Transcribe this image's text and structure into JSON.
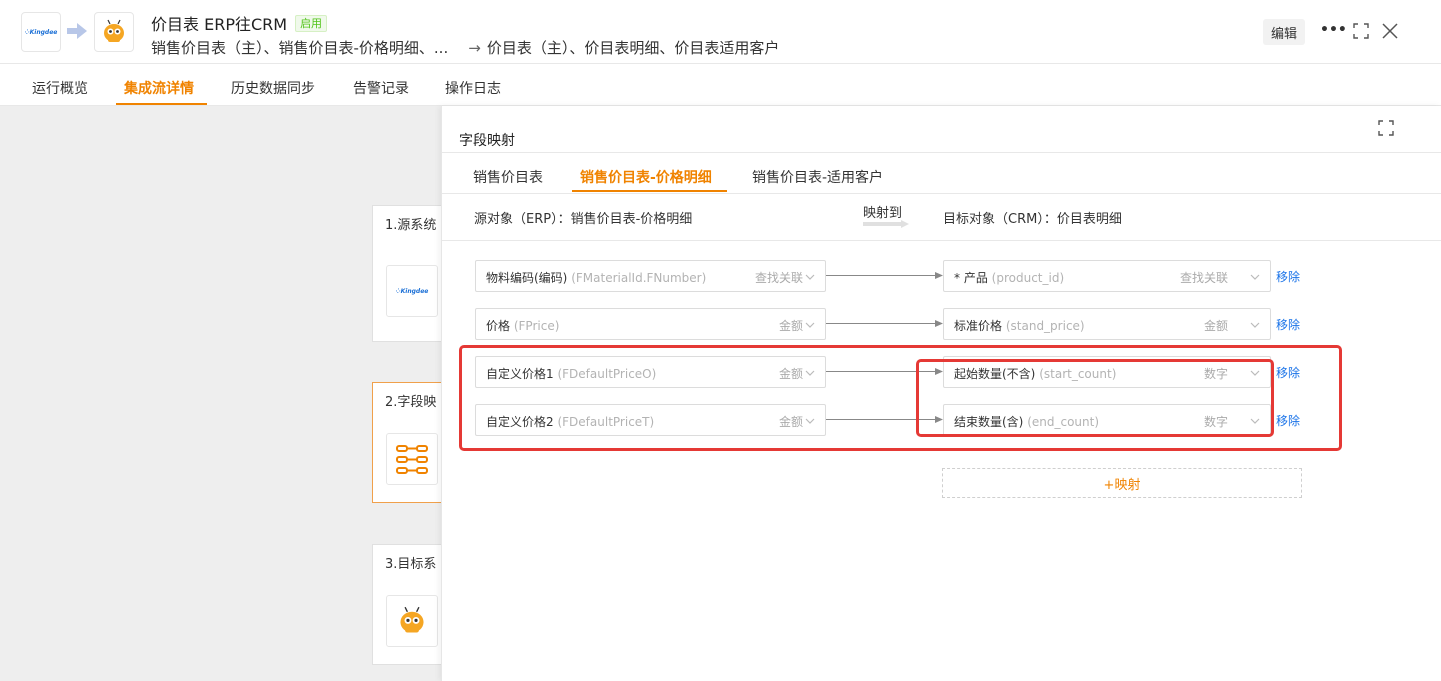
{
  "header": {
    "source_logo_text": "Kingdee",
    "title": "价目表 ERP往CRM",
    "status": "启用",
    "source_objects": "销售价目表（主）、销售价目表-价格明细、...",
    "arrow": "→",
    "target_objects": "价目表（主）、价目表明细、价目表适用客户",
    "edit_label": "编辑",
    "more_label": "•••"
  },
  "tabs": [
    {
      "label": "运行概览"
    },
    {
      "label": "集成流详情"
    },
    {
      "label": "历史数据同步"
    },
    {
      "label": "告警记录"
    },
    {
      "label": "操作日志"
    }
  ],
  "active_tab": "集成流详情",
  "steps": [
    {
      "label": "1.源系统"
    },
    {
      "label": "2.字段映"
    },
    {
      "label": "3.目标系"
    }
  ],
  "panel": {
    "title": "字段映射",
    "tabs": [
      {
        "label": "销售价目表"
      },
      {
        "label": "销售价目表-价格明细"
      },
      {
        "label": "销售价目表-适用客户"
      }
    ],
    "active_tab": "销售价目表-价格明细",
    "source_object": "源对象（ERP）：销售价目表-价格明细",
    "map_to_label": "映射到",
    "target_object": "目标对象（CRM）：价目表明细",
    "mappings": [
      {
        "src_name": "物料编码(编码)",
        "src_code": "(FMaterialId.FNumber)",
        "src_type": "查找关联",
        "tgt_name": "* 产品",
        "tgt_code": "(product_id)",
        "tgt_type": "查找关联",
        "remove": "移除"
      },
      {
        "src_name": "价格",
        "src_code": "(FPrice)",
        "src_type": "金额",
        "tgt_name": "标准价格",
        "tgt_code": "(stand_price)",
        "tgt_type": "金额",
        "remove": "移除"
      },
      {
        "src_name": "自定义价格1",
        "src_code": "(FDefaultPriceO)",
        "src_type": "金额",
        "tgt_name": "起始数量(不含)",
        "tgt_code": "(start_count)",
        "tgt_type": "数字",
        "remove": "移除"
      },
      {
        "src_name": "自定义价格2",
        "src_code": "(FDefaultPriceT)",
        "src_type": "金额",
        "tgt_name": "结束数量(含)",
        "tgt_code": "(end_count)",
        "tgt_type": "数字",
        "remove": "移除"
      }
    ],
    "add_mapping_label": "+映射"
  },
  "colors": {
    "accent": "#f08300",
    "link": "#1a73e8",
    "status_green": "#52c41a",
    "highlight_red": "#e53935"
  },
  "icons": [
    "kingdee-logo",
    "crm-bee-logo",
    "arrow-right-icon",
    "more-icon",
    "fullscreen-icon",
    "close-icon",
    "field-mapping-icon",
    "caret-down-icon"
  ]
}
